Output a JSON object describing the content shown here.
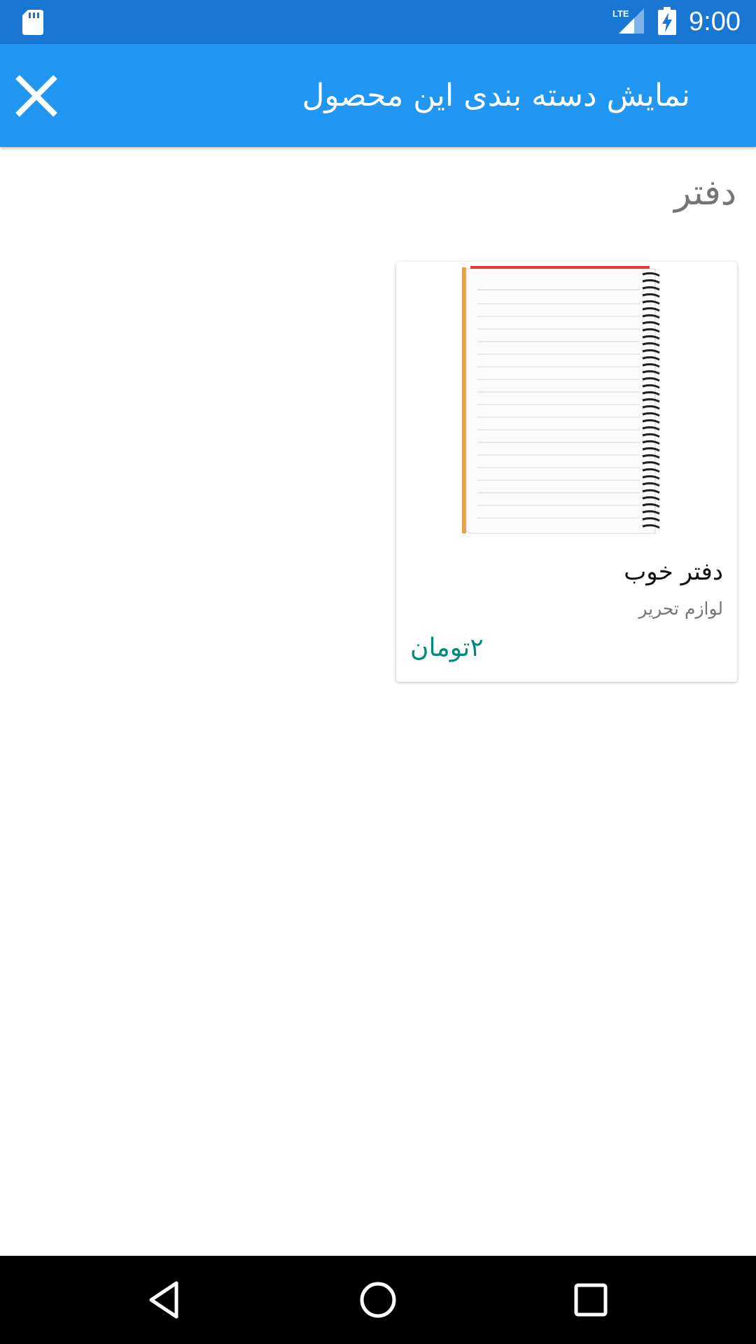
{
  "status_bar": {
    "time": "9:00",
    "network_label": "LTE",
    "icons": [
      "sd-card-icon",
      "lte-signal-icon",
      "battery-charging-icon"
    ]
  },
  "app_bar": {
    "title": "نمایش دسته بندی این محصول",
    "close_icon": "close-icon",
    "background_color": "#2196F3"
  },
  "category": {
    "title": "دفتر"
  },
  "products": [
    {
      "name": "دفتر خوب",
      "category": "لوازم تحریر",
      "price": "۲تومان",
      "image_icon": "spiral-notebook-image"
    }
  ],
  "nav_bar": {
    "buttons": [
      "back-icon",
      "home-icon",
      "recents-icon"
    ]
  },
  "colors": {
    "status_bar": "#1976D2",
    "app_bar": "#2196F3",
    "price": "#00897B"
  }
}
